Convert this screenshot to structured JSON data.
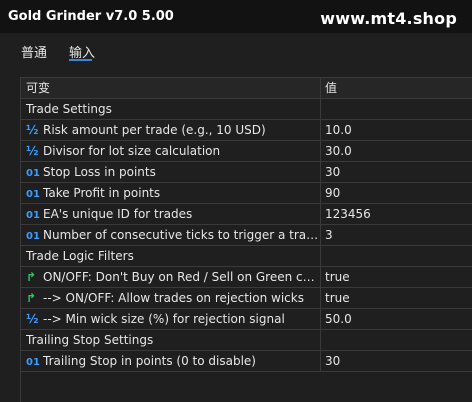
{
  "window": {
    "title": "Gold Grinder v7.0 5.00",
    "watermark": "www.mt4.shop"
  },
  "tabs": [
    {
      "label": "普通"
    },
    {
      "label": "输入"
    }
  ],
  "grid": {
    "columns": {
      "name": "可变",
      "value": "值"
    },
    "rows": [
      {
        "type": "group",
        "name": "Trade Settings"
      },
      {
        "type": "param",
        "icon": "½",
        "name": "Risk amount per trade (e.g., 10 USD)",
        "value": "10.0"
      },
      {
        "type": "param",
        "icon": "½",
        "name": "Divisor for lot size calculation",
        "value": "30.0"
      },
      {
        "type": "param",
        "icon": "01",
        "name": "Stop Loss in points",
        "value": "30"
      },
      {
        "type": "param",
        "icon": "01",
        "name": "Take Profit in points",
        "value": "90"
      },
      {
        "type": "param",
        "icon": "01",
        "name": "EA's unique ID for trades",
        "value": "123456"
      },
      {
        "type": "param",
        "icon": "01",
        "name": "Number of consecutive ticks to trigger a trade",
        "value": "3"
      },
      {
        "type": "group",
        "name": "Trade Logic Filters"
      },
      {
        "type": "param",
        "icon": "↱",
        "name": "ON/OFF: Don't Buy on Red / Sell on Green ca...",
        "value": "true"
      },
      {
        "type": "param",
        "icon": "↱",
        "name": "--> ON/OFF: Allow trades on rejection wicks",
        "value": "true"
      },
      {
        "type": "param",
        "icon": "½",
        "name": "--> Min wick size (%) for rejection signal",
        "value": "50.0"
      },
      {
        "type": "group",
        "name": "Trailing Stop Settings"
      },
      {
        "type": "param",
        "icon": "01",
        "name": "Trailing Stop in points (0 to disable)",
        "value": "30"
      }
    ]
  },
  "colors": {
    "accent": "#3b86d8",
    "number_icon": "#3b9cff",
    "bool_icon": "#2fc460",
    "background": "#1f1f1f",
    "titlebar": "#121212"
  }
}
